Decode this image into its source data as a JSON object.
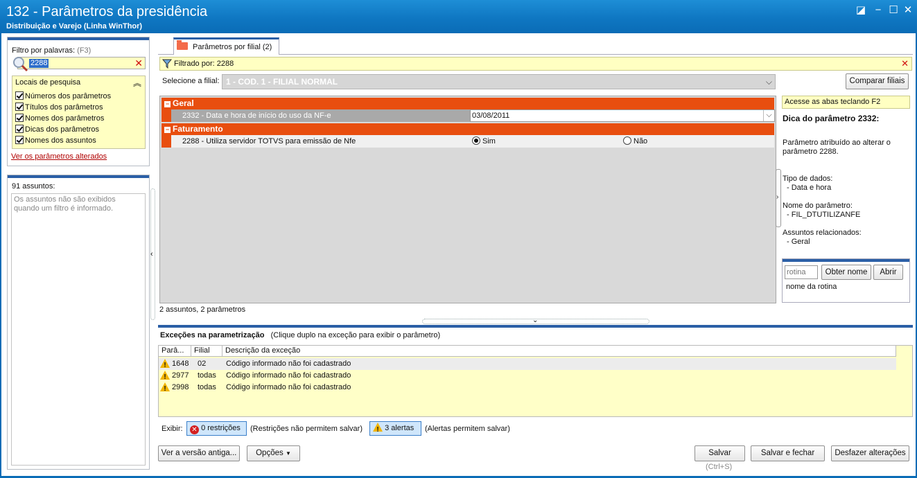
{
  "window": {
    "title": "132 - Parâmetros da presidência",
    "subtitle": "Distribuição e Varejo (Linha WinThor)",
    "controls": {
      "restore": "◪",
      "minimize": "−",
      "maximize": "☐",
      "close": "✕"
    }
  },
  "filter": {
    "label": "Filtro por palavras:",
    "shortcut": "(F3)",
    "value": "2288",
    "search_places_title": "Locais de pesquisa",
    "options": [
      "Números dos parâmetros",
      "Títulos dos parâmetros",
      "Nomes dos parâmetros",
      "Dicas dos parâmetros",
      "Nomes dos assuntos"
    ],
    "changed_link": "Ver os parâmetros alterados"
  },
  "subjects": {
    "count_label": "91 assuntos:",
    "message": "Os assuntos não são exibidos quando um filtro é informado."
  },
  "tab": {
    "label": "Parâmetros por filial",
    "count": "(2)"
  },
  "filtered_by": "Filtrado por: 2288",
  "filial": {
    "label": "Selecione a filial:",
    "value": "1 - COD. 1 - FILIAL NORMAL",
    "compare_button": "Comparar filiais"
  },
  "groups": [
    {
      "name": "Geral",
      "params": [
        {
          "label": "2332 - Data e hora de início do uso da NF-e",
          "value": "03/08/2011"
        }
      ]
    },
    {
      "name": "Faturamento",
      "params": [
        {
          "label": "2288 - Utiliza servidor TOTVS para emissão de Nfe",
          "option_yes": "Sim",
          "option_no": "Não",
          "selected": "Sim"
        }
      ]
    }
  ],
  "summary": "2 assuntos, 2 parâmetros",
  "tip": {
    "hint": "Acesse as abas teclando F2",
    "title": "Dica do parâmetro 2332:",
    "description": "Parâmetro atribuído ao alterar o parâmetro 2288.",
    "data_type_label": "Tipo de dados:",
    "data_type": "- Data e hora",
    "param_name_label": "Nome do parâmetro:",
    "param_name": "- FIL_DTUTILIZANFE",
    "related_label": "Assuntos relacionados:",
    "related": "- Geral"
  },
  "rotina": {
    "placeholder": "rotina",
    "get_name_button": "Obter nome",
    "open_button": "Abrir",
    "name_label": "nome da rotina"
  },
  "exceptions": {
    "title": "Exceções na parametrização",
    "hint": "(Clique duplo na exceção para exibir o parâmetro)",
    "columns": [
      "Parâ...",
      "Filial",
      "Descrição da exceção"
    ],
    "rows": [
      {
        "param": "1648",
        "filial": "02",
        "description": "Código informado não foi cadastrado"
      },
      {
        "param": "2977",
        "filial": "todas",
        "description": "Código informado não foi cadastrado"
      },
      {
        "param": "2998",
        "filial": "todas",
        "description": "Código informado não foi cadastrado"
      }
    ],
    "show_label": "Exibir:",
    "restrictions_button": "0 restrições",
    "restrictions_note": "(Restrições não permitem salvar)",
    "alerts_button": "3 alertas",
    "alerts_note": "(Alertas permitem salvar)"
  },
  "footer": {
    "old_version_button": "Ver a versão antiga...",
    "options_button": "Opções",
    "save_button": "Salvar",
    "save_shortcut": "(Ctrl+S)",
    "save_close_button": "Salvar e fechar",
    "undo_button": "Desfazer alterações"
  },
  "colors": {
    "accent": "#e84e0f",
    "title_bar": "#0f77c2",
    "highlight": "#ffffc2"
  }
}
